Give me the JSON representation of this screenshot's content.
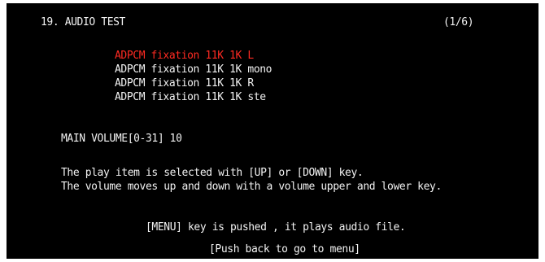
{
  "header": {
    "title": "19. AUDIO TEST",
    "page_indicator": "(1/6)"
  },
  "menu": {
    "items": [
      {
        "label": "ADPCM fixation 11K 1K L",
        "selected": true
      },
      {
        "label": "ADPCM fixation 11K 1K mono",
        "selected": false
      },
      {
        "label": "ADPCM fixation 11K 1K R",
        "selected": false
      },
      {
        "label": "ADPCM fixation 11K 1K ste",
        "selected": false
      }
    ]
  },
  "volume": {
    "text": "MAIN VOLUME[0-31] 10",
    "range": "0-31",
    "value": 10
  },
  "help": {
    "line1": "The play item is selected with [UP] or [DOWN] key.",
    "line2": "The volume moves up and down with a volume upper and lower key."
  },
  "footer": {
    "prompt": "[MENU] key is pushed , it plays audio file.",
    "back": "[Push back to go to menu]"
  },
  "colors": {
    "background": "#000000",
    "text": "#f2f2f2",
    "selected": "#ff2a22"
  }
}
